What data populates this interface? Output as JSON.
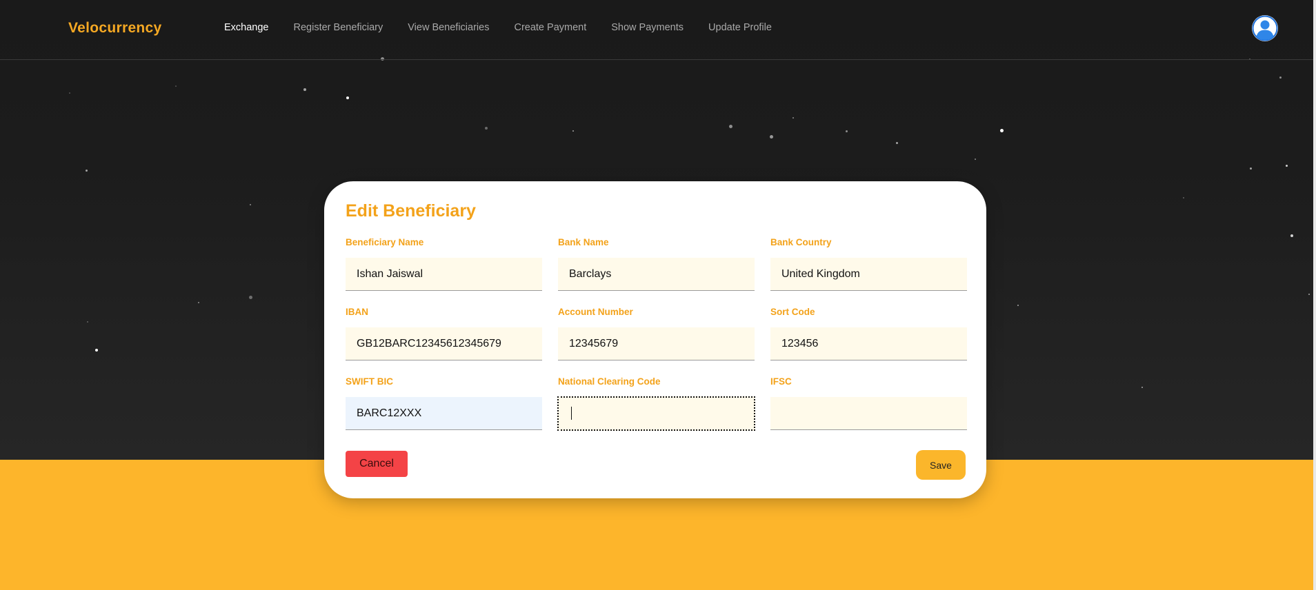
{
  "app": {
    "brand": "Velocurrency"
  },
  "nav": {
    "items": [
      {
        "label": "Exchange",
        "active": true
      },
      {
        "label": "Register Beneficiary"
      },
      {
        "label": "View Beneficiaries"
      },
      {
        "label": "Create Payment"
      },
      {
        "label": "Show Payments"
      },
      {
        "label": "Update Profile"
      }
    ],
    "avatar_icon": "user-avatar-icon"
  },
  "modal": {
    "title": "Edit Beneficiary",
    "fields": {
      "beneficiary_name": {
        "label": "Beneficiary Name",
        "value": "Ishan Jaiswal"
      },
      "bank_name": {
        "label": "Bank Name",
        "value": "Barclays"
      },
      "bank_country": {
        "label": "Bank Country",
        "value": "United Kingdom"
      },
      "iban": {
        "label": "IBAN",
        "value": "GB12BARC12345612345679"
      },
      "account_number": {
        "label": "Account Number",
        "value": "12345679"
      },
      "sort_code": {
        "label": "Sort Code",
        "value": "123456"
      },
      "swift_bic": {
        "label": "SWIFT BIC",
        "value": "BARC12XXX"
      },
      "national_clearing_code": {
        "label": "National Clearing Code",
        "value": ""
      },
      "ifsc": {
        "label": "IFSC",
        "value": ""
      }
    },
    "cancel_label": "Cancel",
    "save_label": "Save"
  },
  "colors": {
    "accent": "#f3a21a",
    "band": "#fdb52b",
    "cancel": "#f44346",
    "hero": "#1c1c1c"
  }
}
